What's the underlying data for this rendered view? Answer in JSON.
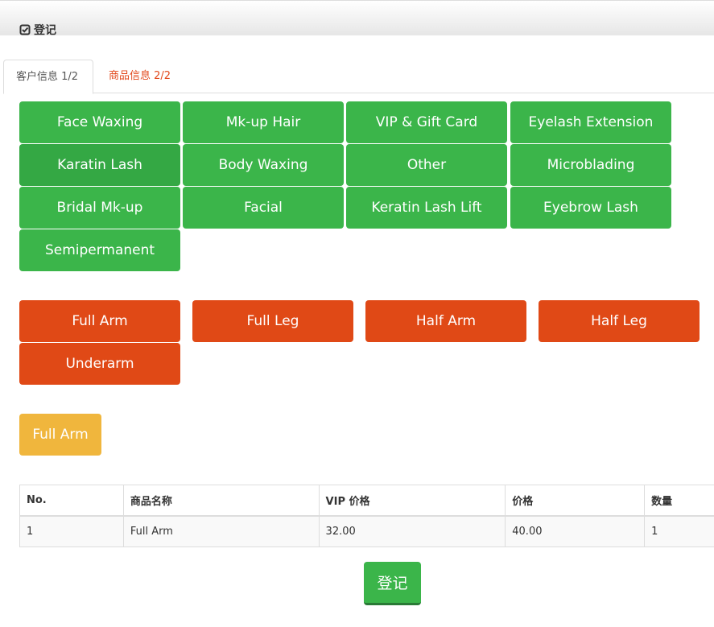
{
  "header": {
    "title": "登记",
    "icon": "check-square-icon"
  },
  "tabs": [
    {
      "label": "客户信息 1/2",
      "active": true
    },
    {
      "label": "商品信息 2/2",
      "active": false
    }
  ],
  "categories": [
    "Face Waxing",
    "Mk-up Hair",
    "VIP & Gift Card",
    "Eyelash Extension",
    "Karatin Lash",
    "Body Waxing",
    "Other",
    "Microblading",
    "Bridal Mk-up",
    "Facial",
    "Keratin Lash Lift",
    "Eyebrow Lash",
    "Semipermanent"
  ],
  "products": [
    "Full Arm",
    "Full Leg",
    "Half Arm",
    "Half Leg",
    "Underarm"
  ],
  "selected": [
    "Full Arm"
  ],
  "table": {
    "headers": [
      "No.",
      "商品名称",
      "VIP 价格",
      "价格",
      "数量"
    ],
    "rows": [
      [
        "1",
        "Full Arm",
        "32.00",
        "40.00",
        "1"
      ]
    ]
  },
  "submit_label": "登记",
  "colors": {
    "category": "#3bb54a",
    "product": "#e04916",
    "selected": "#f0b63d",
    "tab_inactive": "#e2471a"
  }
}
